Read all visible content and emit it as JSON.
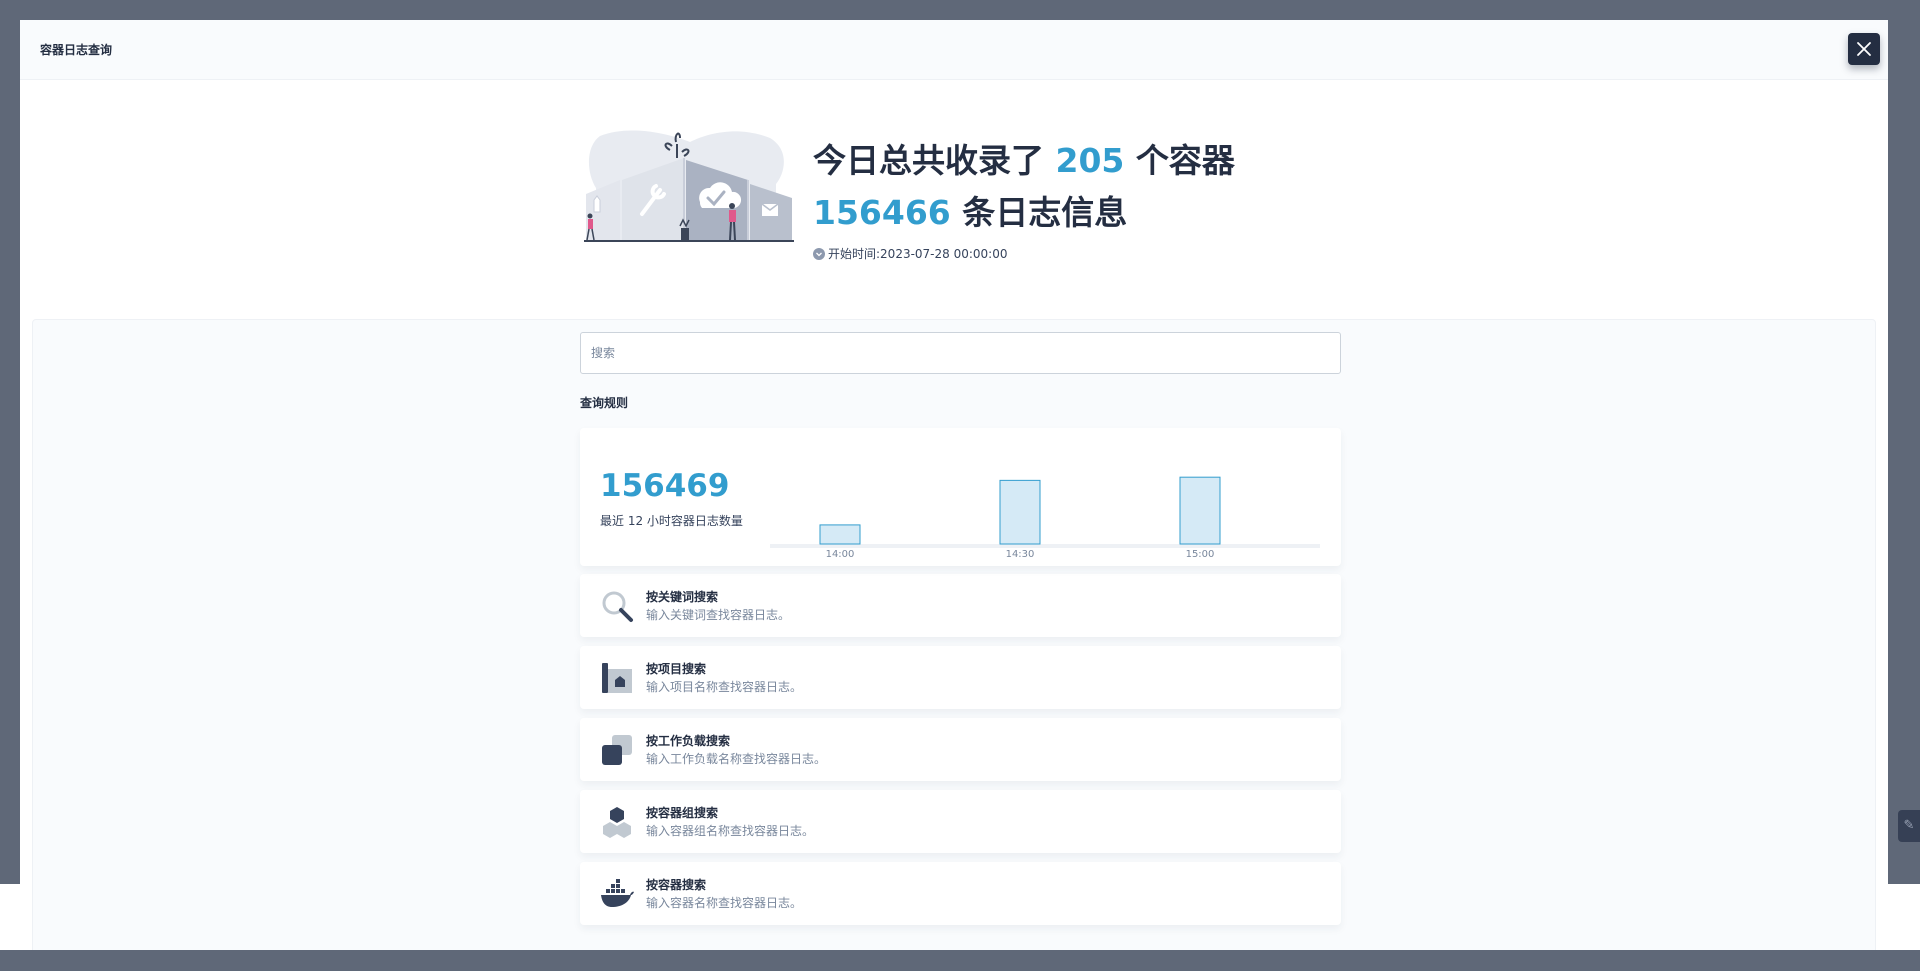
{
  "modal": {
    "title": "容器日志查询"
  },
  "hero": {
    "line1_prefix": "今日总共收录了",
    "container_count": "205",
    "line1_suffix": "个容器",
    "log_count": "156466",
    "line2_suffix": "条日志信息",
    "start_time_label": "开始时间:",
    "start_time": "2023-07-28 00:00:00"
  },
  "search": {
    "placeholder": "搜索",
    "value": ""
  },
  "rules": {
    "title": "查询规则",
    "items": [
      {
        "icon": "magnifier-icon",
        "title": "按关键词搜索",
        "desc": "输入关键词查找容器日志。"
      },
      {
        "icon": "project-icon",
        "title": "按项目搜索",
        "desc": "输入项目名称查找容器日志。"
      },
      {
        "icon": "workload-icon",
        "title": "按工作负载搜索",
        "desc": "输入工作负载名称查找容器日志。"
      },
      {
        "icon": "pod-icon",
        "title": "按容器组搜索",
        "desc": "输入容器组名称查找容器日志。"
      },
      {
        "icon": "docker-icon",
        "title": "按容器搜索",
        "desc": "输入容器名称查找容器日志。"
      }
    ]
  },
  "stats": {
    "total": "156469",
    "label": "最近 12 小时容器日志数量"
  },
  "chart_data": {
    "type": "bar",
    "categories": [
      "14:00",
      "14:30",
      "15:00"
    ],
    "values": [
      0.3,
      1.0,
      1.05
    ],
    "ylim": [
      0,
      1.1
    ],
    "grid": false,
    "bar_color": "#d5eaf6",
    "bar_stroke": "#329dce"
  },
  "colors": {
    "accent": "#329dce",
    "dark": "#242e42",
    "muted": "#79879c"
  }
}
